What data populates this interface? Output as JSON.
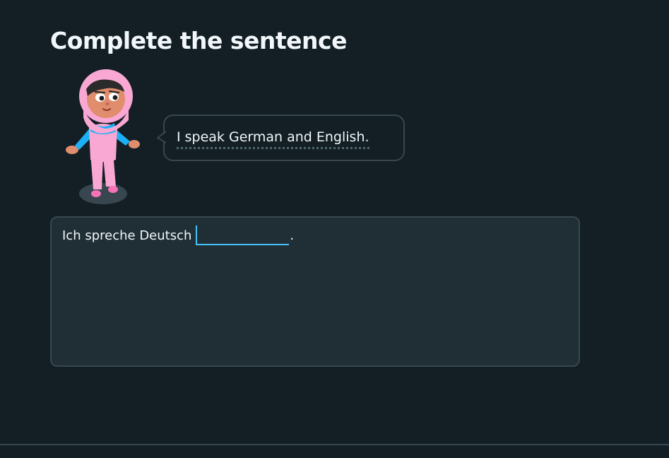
{
  "page": {
    "title": "Complete the sentence"
  },
  "prompt": {
    "speech_text": "I speak German and English."
  },
  "exercise": {
    "sentence_prefix": "Ich spreche Deutsch",
    "answer_value": "",
    "sentence_suffix": "."
  },
  "colors": {
    "background": "#131f24",
    "panel": "#202f36",
    "border": "#37464f",
    "text": "#f1f7fb",
    "input_accent": "#49c0f8",
    "hijab_pink": "#f9a8d4",
    "shirt_blue": "#1cb0f6"
  },
  "icons": {
    "character": "character-illustration"
  }
}
